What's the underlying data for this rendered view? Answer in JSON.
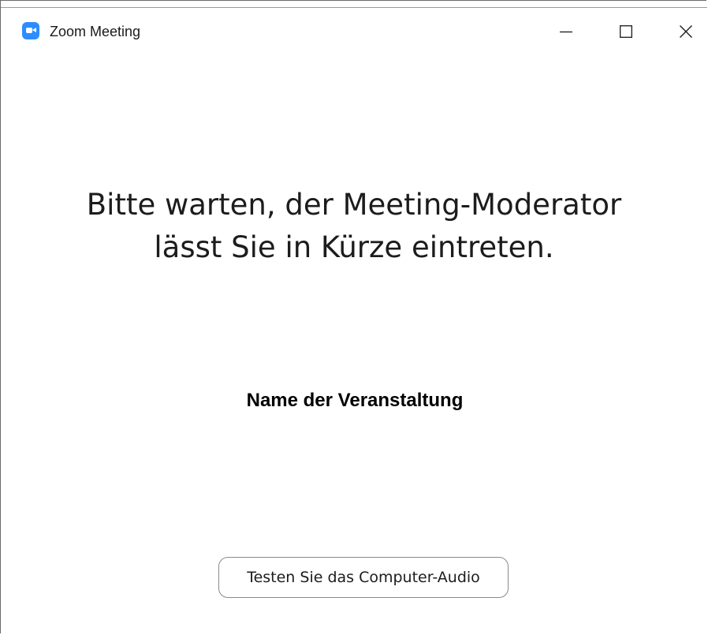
{
  "window": {
    "title": "Zoom Meeting",
    "app_icon": "zoom-camera-icon",
    "controls": {
      "minimize_icon": "minimize-icon",
      "maximize_icon": "maximize-icon",
      "close_icon": "close-icon"
    }
  },
  "main": {
    "waiting_line_1": "Bitte warten, der Meeting-Moderator",
    "waiting_line_2": "lässt Sie in Kürze eintreten.",
    "event_name": "Name der Veranstaltung",
    "audio_test_button": "Testen Sie das Computer-Audio"
  },
  "colors": {
    "brand": "#2d8cff",
    "text": "#1c1c1c",
    "button_border": "#8a8a8a"
  }
}
